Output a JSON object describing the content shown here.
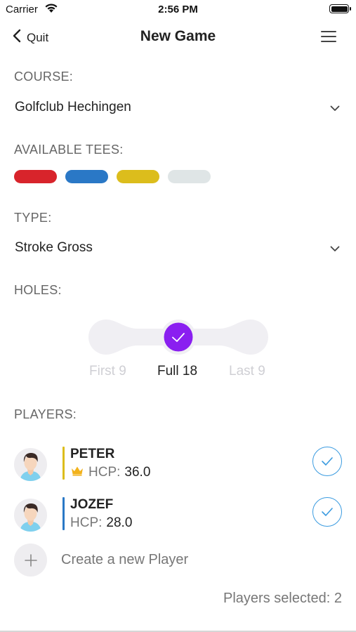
{
  "status_bar": {
    "carrier": "Carrier",
    "time": "2:56 PM"
  },
  "nav": {
    "back_label": "Quit",
    "title": "New Game",
    "menu_icon": "hamburger-menu-icon"
  },
  "course": {
    "label": "COURSE:",
    "value": "Golfclub Hechingen"
  },
  "tees": {
    "label": "AVAILABLE TEES:",
    "items": [
      {
        "name": "red",
        "color": "#d8242b"
      },
      {
        "name": "blue",
        "color": "#2a78c6"
      },
      {
        "name": "yellow",
        "color": "#dcbd1c"
      },
      {
        "name": "white",
        "color": "#dfe5e6"
      }
    ]
  },
  "type": {
    "label": "TYPE:",
    "value": "Stroke Gross"
  },
  "holes": {
    "label": "HOLES:",
    "options": [
      "First 9",
      "Full 18",
      "Last 9"
    ],
    "selected": "Full 18",
    "accent_color": "#8a1ff0"
  },
  "players": {
    "label": "PLAYERS:",
    "items": [
      {
        "name": "PETER",
        "hcp_label": "HCP:",
        "hcp": "36.0",
        "bar_color": "#dcbd1c",
        "has_crown": true,
        "selected": true
      },
      {
        "name": "JOZEF",
        "hcp_label": "HCP:",
        "hcp": "28.0",
        "bar_color": "#2a78c6",
        "has_crown": false,
        "selected": true
      }
    ],
    "create_label": "Create a new Player",
    "selected_text": "Players selected: 2"
  }
}
